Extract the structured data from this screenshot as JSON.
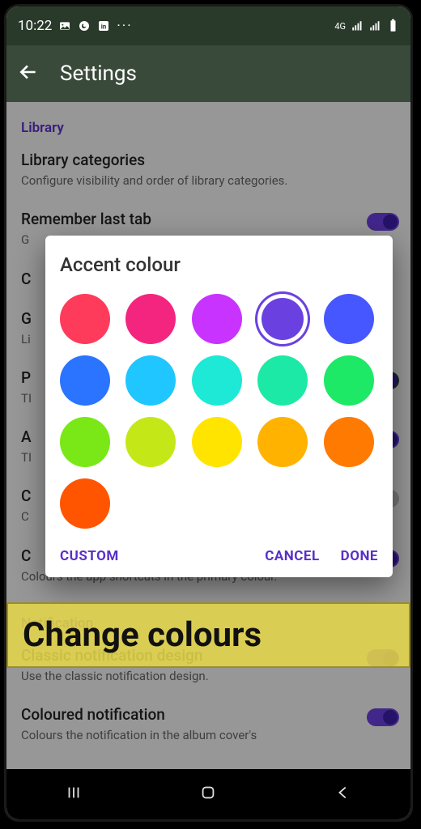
{
  "status": {
    "time": "10:22",
    "network_label": "4G"
  },
  "appbar": {
    "title": "Settings"
  },
  "sections": {
    "library_header": "Library",
    "notification_header": "Notification"
  },
  "settings": {
    "lib_cat": {
      "title": "Library categories",
      "sub": "Configure visibility and order of library categories."
    },
    "remember_tab": {
      "title": "Remember last tab",
      "sub": "G"
    },
    "item_c": {
      "title": "C",
      "sub": ""
    },
    "item_g": {
      "title": "G",
      "sub": "Li"
    },
    "item_p": {
      "title": "P",
      "sub": "TI"
    },
    "item_a": {
      "title": "A",
      "sub": "TI"
    },
    "item_c2": {
      "title": "C",
      "sub": "C"
    },
    "shortcuts": {
      "title": "C",
      "sub": "Colours the app shortcuts in the primary colour."
    },
    "classic": {
      "title": "Classic notification design",
      "sub": "Use the classic notification design."
    },
    "coloured": {
      "title": "Coloured notification",
      "sub": "Colours the notification in the album cover's"
    }
  },
  "dialog": {
    "title": "Accent colour",
    "custom": "CUSTOM",
    "cancel": "CANCEL",
    "done": "DONE",
    "selected_index": 3,
    "swatches": [
      "#ff3b5c",
      "#f4257f",
      "#c833ff",
      "#6b40e0",
      "#4757ff",
      "#2a74ff",
      "#20c6ff",
      "#1de9d6",
      "#1de9a6",
      "#1de966",
      "#7ae817",
      "#c4e817",
      "#ffe400",
      "#ffb300",
      "#ff7a00",
      "#ff5500"
    ]
  },
  "banner": {
    "text": "Change colours"
  }
}
